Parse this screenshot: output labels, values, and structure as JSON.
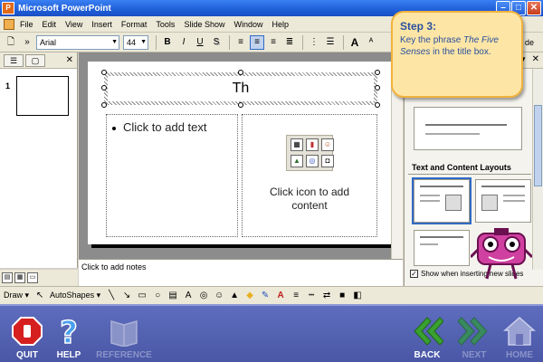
{
  "window": {
    "title": "Microsoft PowerPoint",
    "buttons": {
      "minimize": "–",
      "maximize": "□",
      "close": "✕"
    }
  },
  "menu": {
    "items": [
      "File",
      "Edit",
      "View",
      "Insert",
      "Format",
      "Tools",
      "Slide Show",
      "Window",
      "Help"
    ]
  },
  "toolbar": {
    "font": "Arial",
    "size": "44",
    "bold": "B",
    "italic": "I",
    "underline": "U",
    "shadow": "S",
    "grow_font": "A",
    "design_label": "de"
  },
  "left_panel": {
    "slide_number": "1"
  },
  "slide": {
    "title_text": "Th",
    "bullet_placeholder": "Click to add text",
    "content_placeholder_line1": "Click icon to add",
    "content_placeholder_line2": "content"
  },
  "notes": {
    "placeholder": "Click to add notes"
  },
  "task_pane": {
    "section_title": "Text and Content Layouts",
    "checkbox_label": "Show when inserting new slides"
  },
  "draw_toolbar": {
    "draw_label": "Draw",
    "autoshapes_label": "AutoShapes"
  },
  "callout": {
    "heading": "Step 3:",
    "text_before": "Key the phrase ",
    "phrase": "The Five Senses",
    "text_after": " in the title box."
  },
  "nav": {
    "quit": "QUIT",
    "help": "HELP",
    "reference": "REFERENCE",
    "back": "BACK",
    "next": "NEXT",
    "home": "HOME"
  },
  "colors": {
    "nav_bar": "#4a57a6",
    "callout_bg": "#fde6a5",
    "callout_border": "#f2b23c",
    "callout_text": "#2a4fa0",
    "quit_red": "#d62020",
    "back_green": "#3aa030",
    "mascot": "#d040a0"
  }
}
